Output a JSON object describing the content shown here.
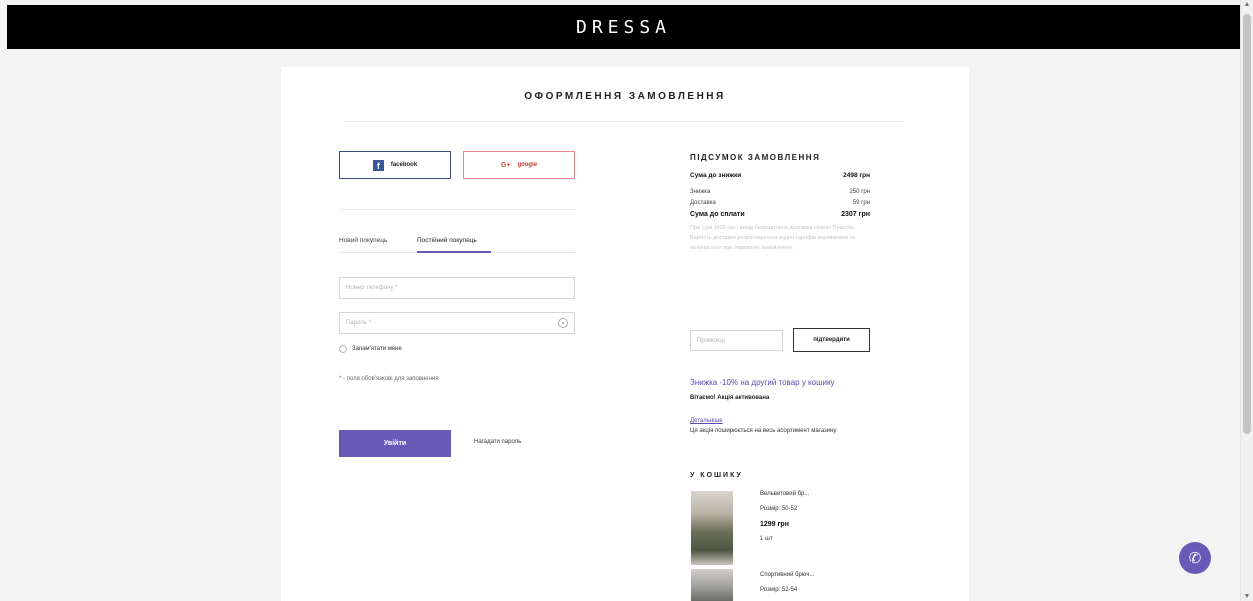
{
  "header": {
    "logo": "DRESSA"
  },
  "page": {
    "title": "ОФОРМЛЕННЯ ЗАМОВЛЕННЯ"
  },
  "social": {
    "facebook_label": "facebook",
    "google_label": "google"
  },
  "tabs": [
    {
      "label": "Новий покупець",
      "active": false
    },
    {
      "label": "Постійний покупець",
      "active": true
    }
  ],
  "form": {
    "phone_placeholder": "Номер телефону *",
    "password_placeholder": "Пароль *",
    "remember_label": "Запам'ятати мене",
    "required_note": "* - поля обов'язкові для заповнення",
    "login_label": "Увійти",
    "forgot_label": "Нагадати пароль"
  },
  "summary": {
    "title": "ПІДСУМОК ЗАМОВЛЕННЯ",
    "subtotal_label": "Сума до знижки",
    "subtotal_value": "2498 грн",
    "discount_label": "Знижка",
    "discount_value": "250 грн",
    "delivery_label": "Доставка",
    "delivery_value": "59 грн",
    "total_label": "Сума до сплати",
    "total_value": "2307 грн",
    "note": "При сумі 1500 грн і вище безкоштовна доставка Новою Поштою. Вартість доставки розраховується згідно тарифів перевізника та оплачується при отриманні замовлення."
  },
  "promo": {
    "placeholder": "Промокод",
    "button_label": "підтвердити"
  },
  "promotion": {
    "title": "Знижка -10% на другий товар у кошику",
    "subtitle": "Вітаємо! Акція активована",
    "details_link": "Детальніше",
    "details_text": "Ця акція поширюється на весь асортимент магазину"
  },
  "cart": {
    "title": "У КОШИКУ",
    "items": [
      {
        "name": "Вельветовий бр...",
        "size": "Розмір: 50-52",
        "price": "1299 грн",
        "qty": "1 шт"
      },
      {
        "name": "Спортивний брюч...",
        "size": "Розмір: 52-54"
      }
    ]
  },
  "colors": {
    "accent": "#6a5ab8",
    "header_bg": "#000000",
    "page_bg": "#f4f4f4"
  }
}
